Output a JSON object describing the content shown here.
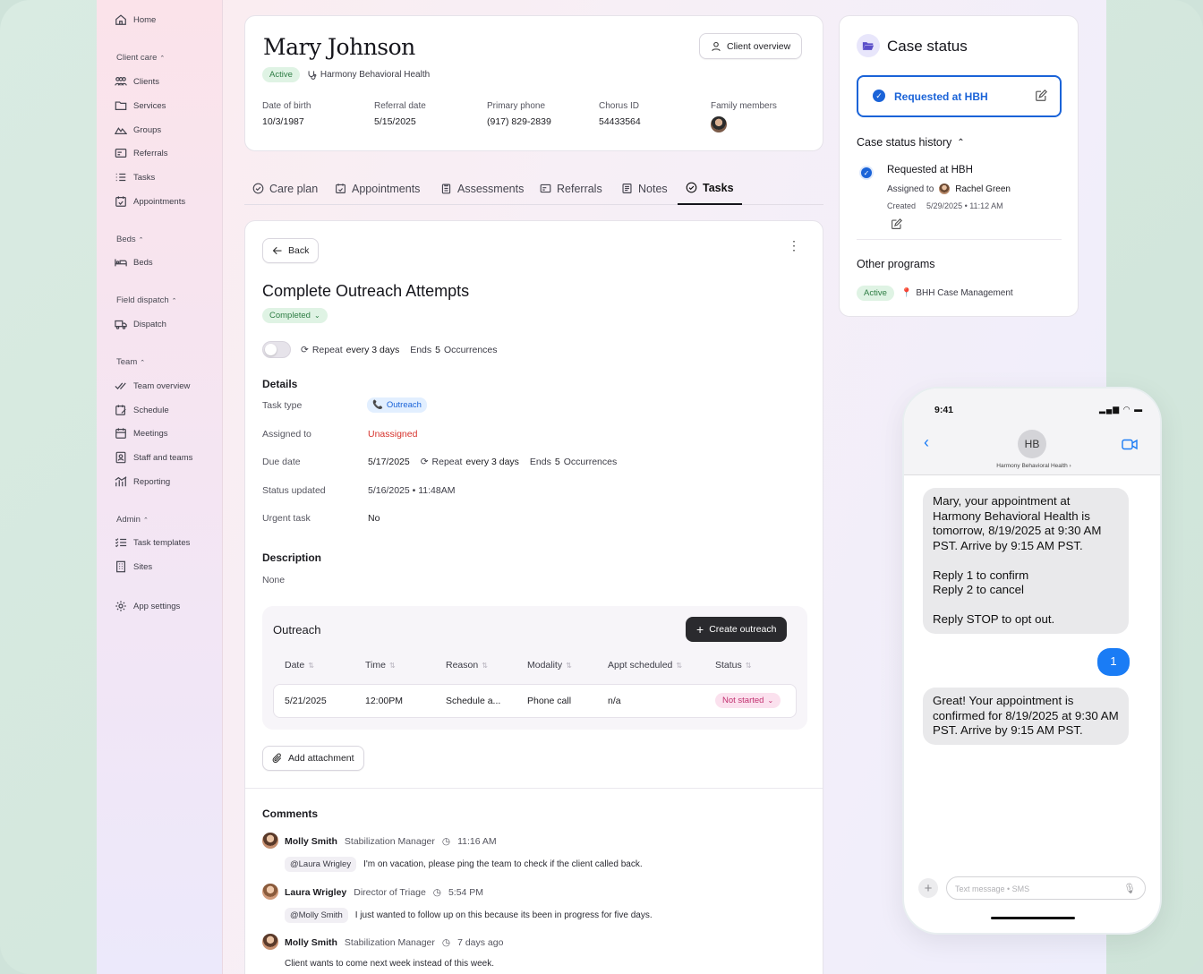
{
  "sidebar": {
    "home": "Home",
    "sections": {
      "client_care": "Client care",
      "beds": "Beds",
      "field_dispatch": "Field dispatch",
      "team": "Team",
      "admin": "Admin"
    },
    "items": {
      "clients": "Clients",
      "services": "Services",
      "groups": "Groups",
      "referrals": "Referrals",
      "tasks": "Tasks",
      "appointments": "Appointments",
      "beds": "Beds",
      "dispatch": "Dispatch",
      "team_overview": "Team overview",
      "schedule": "Schedule",
      "meetings": "Meetings",
      "staff_and_teams": "Staff and teams",
      "reporting": "Reporting",
      "task_templates": "Task templates",
      "sites": "Sites",
      "app_settings": "App settings"
    }
  },
  "client": {
    "name": "Mary Johnson",
    "status": "Active",
    "org": "Harmony Behavioral Health",
    "overview_button": "Client overview",
    "facts": [
      {
        "label": "Date of birth",
        "value": "10/3/1987"
      },
      {
        "label": "Referral date",
        "value": "5/15/2025"
      },
      {
        "label": "Primary phone",
        "value": "(917) 829-2839"
      },
      {
        "label": "Chorus ID",
        "value": "54433564"
      },
      {
        "label": "Family members",
        "value": ""
      }
    ]
  },
  "tabs": [
    "Care plan",
    "Appointments",
    "Assessments",
    "Referrals",
    "Notes",
    "Tasks"
  ],
  "task": {
    "back": "Back",
    "title": "Complete Outreach Attempts",
    "status": "Completed",
    "repeat_prefix": "Repeat",
    "repeat_value": "every 3 days",
    "ends_prefix": "Ends",
    "ends_count": "5",
    "ends_suffix": "Occurrences",
    "details_title": "Details",
    "details": {
      "task_type_label": "Task type",
      "task_type": "Outreach",
      "assigned_label": "Assigned to",
      "assigned": "Unassigned",
      "due_label": "Due date",
      "due": "5/17/2025",
      "status_updated_label": "Status updated",
      "status_updated": "5/16/2025 • 11:48AM",
      "urgent_label": "Urgent task",
      "urgent": "No"
    },
    "description_title": "Description",
    "description": "None",
    "outreach": {
      "title": "Outreach",
      "create_button": "Create outreach",
      "columns": [
        "Date",
        "Time",
        "Reason",
        "Modality",
        "Appt scheduled",
        "Status"
      ],
      "rows": [
        {
          "date": "5/21/2025",
          "time": "12:00PM",
          "reason": "Schedule a...",
          "modality": "Phone call",
          "appt": "n/a",
          "status": "Not started"
        }
      ]
    },
    "add_attachment": "Add attachment",
    "comments_title": "Comments",
    "comments": [
      {
        "name": "Molly Smith",
        "role": "Stabilization Manager",
        "time": "11:16 AM",
        "mention": "@Laura Wrigley",
        "text": "I'm on vacation, please ping the team to check if the client called back."
      },
      {
        "name": "Laura Wrigley",
        "role": "Director of Triage",
        "time": "5:54 PM",
        "mention": "@Molly Smith",
        "text": "I just wanted to follow up on this because its been in progress for five days."
      },
      {
        "name": "Molly Smith",
        "role": "Stabilization Manager",
        "time": "7 days ago",
        "mention": "",
        "text": "Client wants to come next week instead of this week."
      }
    ]
  },
  "case_status": {
    "title": "Case status",
    "current": "Requested at HBH",
    "history_title": "Case status history",
    "history": {
      "status": "Requested at HBH",
      "assigned_label": "Assigned to",
      "assignee": "Rachel Green",
      "created_label": "Created",
      "created": "5/29/2025 • 11:12 AM"
    },
    "other_title": "Other programs",
    "other_status": "Active",
    "other_program": "BHH Case Management"
  },
  "phone": {
    "time": "9:41",
    "contact_initials": "HB",
    "contact_name": "Harmony Behavioral Health",
    "messages": [
      {
        "from": "them",
        "text": "Mary, your appointment at Harmony Behavioral Health is tomorrow, 8/19/2025 at 9:30 AM PST. Arrive by 9:15 AM PST.\n\nReply 1 to confirm\nReply 2 to cancel\n\nReply STOP to opt out."
      },
      {
        "from": "me",
        "text": "1"
      },
      {
        "from": "them",
        "text": "Great! Your appointment is confirmed for 8/19/2025 at 9:30 AM PST. Arrive by 9:15 AM PST."
      }
    ],
    "input_placeholder": "Text message • SMS"
  },
  "colors": {
    "accent_blue": "#1a63d8",
    "unassigned_red": "#d6322c",
    "active_green": "#2e7d44",
    "dark_button": "#2a2a2e"
  }
}
